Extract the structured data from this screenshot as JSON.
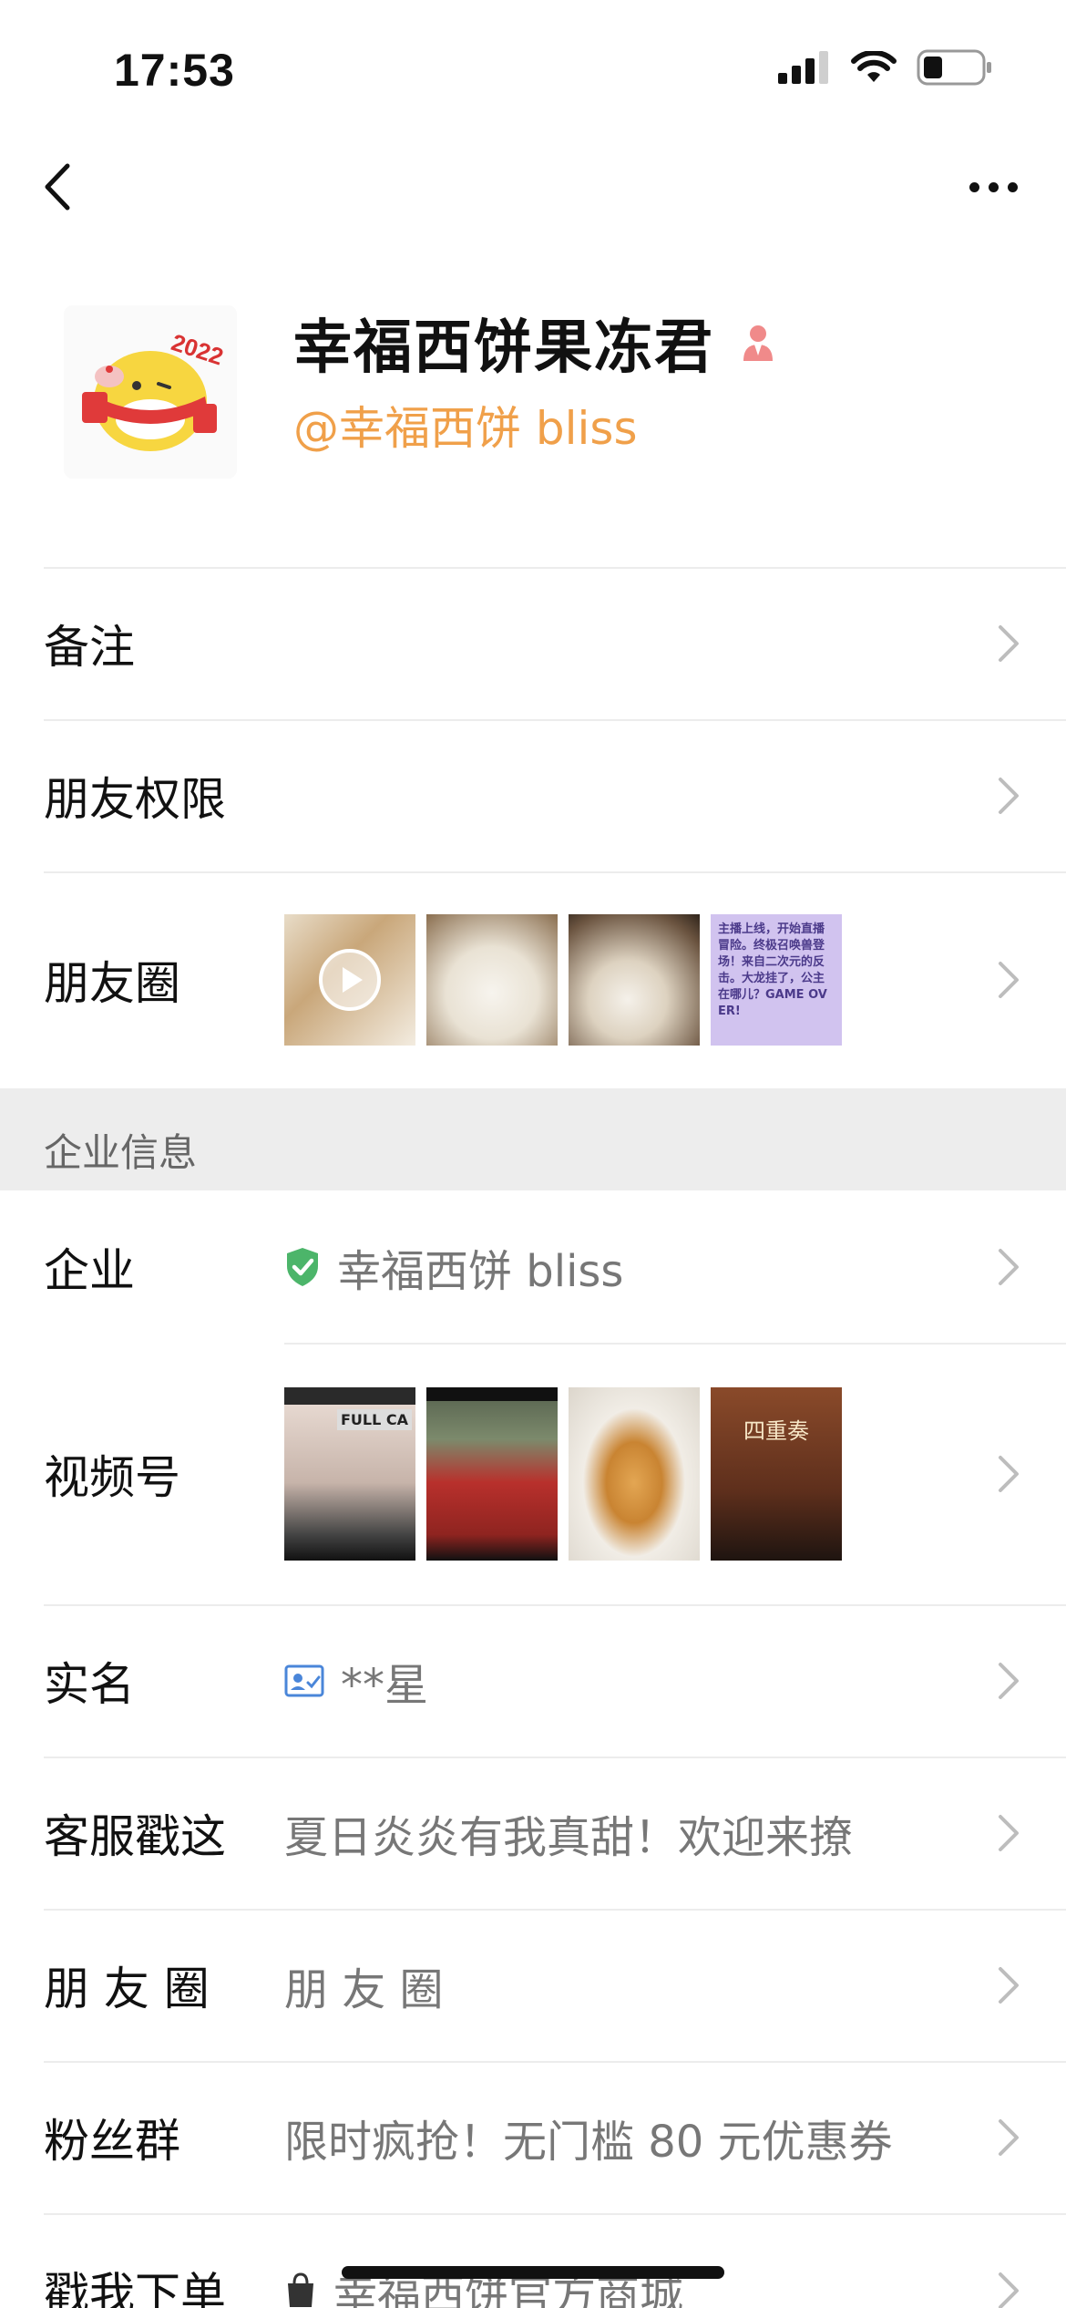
{
  "status": {
    "time": "17:53"
  },
  "profile": {
    "name": "幸福西饼果冻君",
    "handle": "@幸福西饼 bliss",
    "colors": {
      "handle": "#f0a04a",
      "badge": "#f08a8a"
    }
  },
  "rows": {
    "remark": {
      "label": "备注"
    },
    "friend_permission": {
      "label": "朋友权限"
    },
    "moments": {
      "label": "朋友圈",
      "thumbs": [
        {
          "text": ""
        },
        {
          "text": ""
        },
        {
          "text": ""
        },
        {
          "text": "主播上线，开始直播冒险。终极召唤兽登场！来自二次元的反击。大龙挂了，公主在哪儿？GAME OVER!"
        }
      ]
    },
    "section": {
      "title": "企业信息"
    },
    "enterprise": {
      "label": "企业",
      "value": "幸福西饼 bliss",
      "verified_color": "#4cb56a"
    },
    "channels": {
      "label": "视频号",
      "thumbs": [
        {
          "text": "FULL CA"
        },
        {
          "text": ""
        },
        {
          "text": ""
        },
        {
          "text": "四重奏"
        }
      ]
    },
    "real_name": {
      "label": "实名",
      "value": "**星"
    },
    "customer_service": {
      "label": "客服戳这",
      "value": "夏日炎炎有我真甜！欢迎来撩"
    },
    "moments2": {
      "label": "朋 友 圈",
      "value": "朋 友 圈"
    },
    "fan_group": {
      "label": "粉丝群",
      "value": "限时疯抢！无门槛 80 元优惠券"
    },
    "order": {
      "label": "戳我下单",
      "value": "幸福西饼官方商城"
    }
  }
}
